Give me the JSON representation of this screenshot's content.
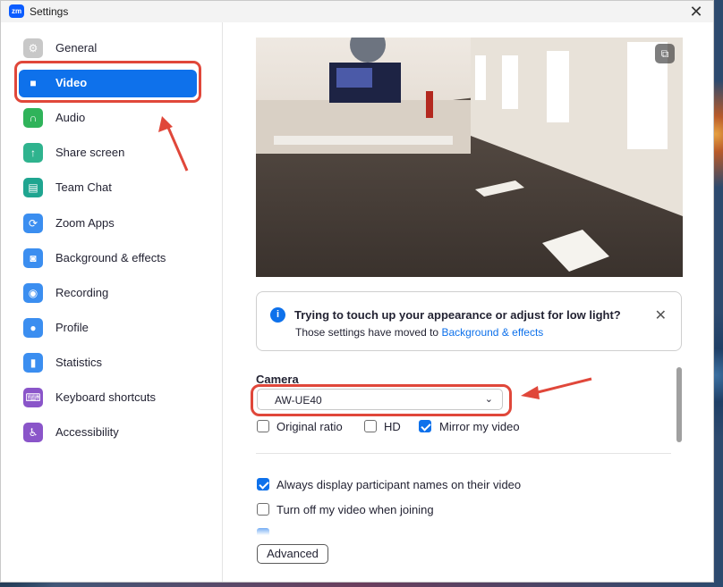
{
  "window": {
    "title": "Settings",
    "app_icon_text": "zm"
  },
  "sidebar": {
    "items": [
      {
        "label": "General",
        "icon": "gear-icon",
        "color": "#c8c8c8",
        "glyph": "⚙"
      },
      {
        "label": "Video",
        "icon": "video-camera-icon",
        "color": "#0e71eb",
        "glyph": "■",
        "active": true
      },
      {
        "label": "Audio",
        "icon": "headphones-icon",
        "color": "#2fb35a",
        "glyph": "∩"
      },
      {
        "label": "Share screen",
        "icon": "share-screen-icon",
        "color": "#2fb38e",
        "glyph": "↑"
      },
      {
        "label": "Team Chat",
        "icon": "chat-icon",
        "color": "#1fa590",
        "glyph": "▤"
      },
      {
        "label": "Zoom Apps",
        "icon": "apps-icon",
        "color": "#3b8ef0",
        "glyph": "⟳"
      },
      {
        "label": "Background & effects",
        "icon": "background-effects-icon",
        "color": "#3b8ef0",
        "glyph": "◙"
      },
      {
        "label": "Recording",
        "icon": "recording-icon",
        "color": "#3b8ef0",
        "glyph": "◉"
      },
      {
        "label": "Profile",
        "icon": "profile-icon",
        "color": "#3b8ef0",
        "glyph": "●"
      },
      {
        "label": "Statistics",
        "icon": "statistics-icon",
        "color": "#3b8ef0",
        "glyph": "▮"
      },
      {
        "label": "Keyboard shortcuts",
        "icon": "keyboard-icon",
        "color": "#8a55c9",
        "glyph": "⌨"
      },
      {
        "label": "Accessibility",
        "icon": "accessibility-icon",
        "color": "#8a55c9",
        "glyph": "♿"
      }
    ]
  },
  "tip": {
    "title": "Trying to touch up your appearance or adjust for low light?",
    "body": "Those settings have moved to ",
    "link": "Background & effects"
  },
  "camera": {
    "label": "Camera",
    "selected": "AW-UE40",
    "options": [
      {
        "label": "Original ratio",
        "checked": false
      },
      {
        "label": "HD",
        "checked": false
      },
      {
        "label": "Mirror my video",
        "checked": true
      }
    ]
  },
  "settings": [
    {
      "label": "Always display participant names on their video",
      "checked": true
    },
    {
      "label": "Turn off my video when joining",
      "checked": false
    }
  ],
  "advanced_label": "Advanced",
  "accent_color": "#0e71eb",
  "annotation_color": "#e0473a"
}
